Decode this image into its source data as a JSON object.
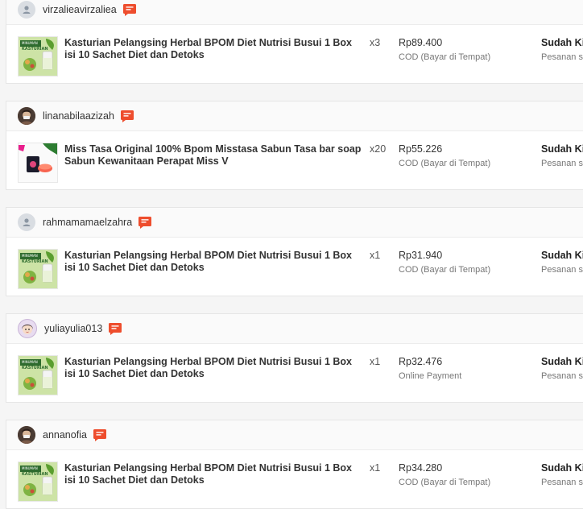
{
  "orders": [
    {
      "username": "virzalieavirzaliea",
      "avatar": "default-avatar",
      "product": "Kasturian Pelangsing Herbal BPOM Diet Nutrisi Busui 1 Box isi 10 Sachet Diet dan Detoks",
      "thumb": "kasturian",
      "qty": "x3",
      "price": "Rp89.400",
      "payment": "COD (Bayar di Tempat)",
      "status": "Sudah Kir",
      "substatus": "Pesanan se"
    },
    {
      "username": "linanabilaazizah",
      "avatar": "photo-avatar",
      "product": "Miss Tasa Original 100% Bpom Misstasa Sabun Tasa bar soap Sabun Kewanitaan Perapat Miss V",
      "thumb": "misstasa",
      "qty": "x20",
      "price": "Rp55.226",
      "payment": "COD (Bayar di Tempat)",
      "status": "Sudah Kir",
      "substatus": "Pesanan se"
    },
    {
      "username": "rahmamamaelzahra",
      "avatar": "default-avatar",
      "product": "Kasturian Pelangsing Herbal BPOM Diet Nutrisi Busui 1 Box isi 10 Sachet Diet dan Detoks",
      "thumb": "kasturian",
      "qty": "x1",
      "price": "Rp31.940",
      "payment": "COD (Bayar di Tempat)",
      "status": "Sudah Kir",
      "substatus": "Pesanan se"
    },
    {
      "username": "yuliayulia013",
      "avatar": "cartoon-avatar",
      "product": "Kasturian Pelangsing Herbal BPOM Diet Nutrisi Busui 1 Box isi 10 Sachet Diet dan Detoks",
      "thumb": "kasturian",
      "qty": "x1",
      "price": "Rp32.476",
      "payment": "Online Payment",
      "status": "Sudah Kir",
      "substatus": "Pesanan se"
    },
    {
      "username": "annanofia",
      "avatar": "photo-avatar",
      "product": "Kasturian Pelangsing Herbal BPOM Diet Nutrisi Busui 1 Box isi 10 Sachet Diet dan Detoks",
      "thumb": "kasturian",
      "qty": "x1",
      "price": "Rp34.280",
      "payment": "COD (Bayar di Tempat)",
      "status": "Sudah Kir",
      "substatus": "Pesanan se"
    }
  ],
  "colors": {
    "chat_icon": "#ee4d2d",
    "status_text": "#222222"
  },
  "icons": {
    "chat": "chat-icon",
    "default_avatar": "user-silhouette-icon"
  }
}
